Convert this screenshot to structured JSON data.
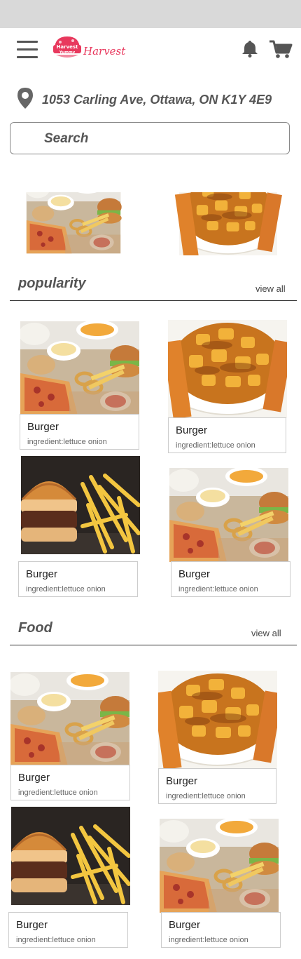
{
  "header": {
    "brand_name": "Harvest",
    "logo_text_line1": "Harvest",
    "logo_text_line2": "Yummy"
  },
  "location": {
    "address": "1053 Carling Ave, Ottawa, ON K1Y 4E9"
  },
  "search": {
    "placeholder": "Search"
  },
  "colors": {
    "brand": "#e8385d",
    "icon_gray": "#555555",
    "status_bar": "#d9d9d9"
  },
  "icons": [
    "menu-icon",
    "bell-icon",
    "cart-icon",
    "location-pin-icon"
  ],
  "banners": [
    {
      "image": "combo-platter"
    },
    {
      "image": "poutine"
    }
  ],
  "sections": {
    "popularity": {
      "title": "popularity",
      "view_all": "view all",
      "items": [
        {
          "image": "combo-platter",
          "name": "Burger",
          "ingredients": "ingredient:lettuce  onion"
        },
        {
          "image": "poutine",
          "name": "Burger",
          "ingredients": "ingredient:lettuce  onion"
        },
        {
          "image": "burger-fries",
          "name": "Burger",
          "ingredients": "ingredient:lettuce  onion"
        },
        {
          "image": "combo-platter",
          "name": "Burger",
          "ingredients": "ingredient:lettuce  onion"
        }
      ]
    },
    "food": {
      "title": "Food",
      "view_all": "view all",
      "items": [
        {
          "image": "combo-platter",
          "name": "Burger",
          "ingredients": "ingredient:lettuce  onion"
        },
        {
          "image": "poutine",
          "name": "Burger",
          "ingredients": "ingredient:lettuce  onion"
        },
        {
          "image": "burger-fries",
          "name": "Burger",
          "ingredients": "ingredient:lettuce  onion"
        },
        {
          "image": "combo-platter",
          "name": "Burger",
          "ingredients": "ingredient:lettuce  onion"
        }
      ]
    }
  }
}
